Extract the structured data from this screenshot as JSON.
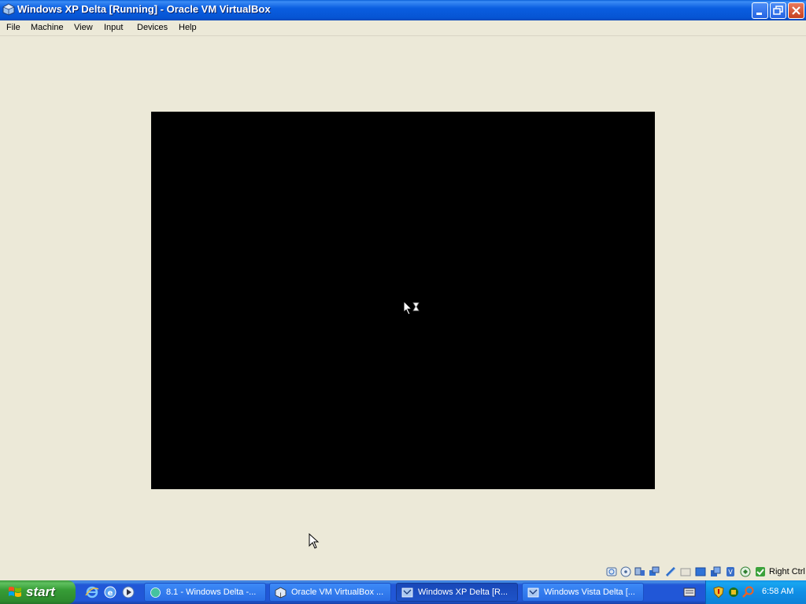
{
  "window": {
    "title": "Windows XP Delta [Running] - Oracle VM VirtualBox",
    "icon": "virtualbox-icon",
    "controls": [
      "minimize-icon",
      "restore-icon",
      "close-icon"
    ]
  },
  "menu": [
    "File",
    "Machine",
    "View",
    "Input",
    "Devices",
    "Help"
  ],
  "vm_screen": {
    "background": "#000000",
    "cursor": "busy-cursor-icon"
  },
  "statusbar": {
    "icons": [
      "hard-disk-icon",
      "optical-drive-icon",
      "audio-icon",
      "network-icon",
      "usb-icon",
      "shared-folders-icon",
      "display-icon",
      "video-capture-icon",
      "virtualization-icon",
      "mouse-integration-icon",
      "guest-additions-icon"
    ],
    "host_key": "Right Ctrl"
  },
  "taskbar": {
    "start_label": "start",
    "quick_launch": [
      "internet-explorer-icon",
      "windows-explorer-icon",
      "media-player-icon"
    ],
    "tasks": [
      {
        "label": "8.1 - Windows Delta -...",
        "icon": "window-app-icon",
        "active": false
      },
      {
        "label": "Oracle VM VirtualBox ...",
        "icon": "virtualbox-icon",
        "active": false
      },
      {
        "label": "Windows XP Delta [R...",
        "icon": "virtualbox-vm-icon",
        "active": true
      },
      {
        "label": "Windows Vista Delta [...",
        "icon": "virtualbox-vm-icon",
        "active": false
      }
    ],
    "tray_icons": [
      "keyboard-icon",
      "security-shield-icon",
      "antivirus-icon",
      "search-icon"
    ],
    "clock": "6:58 AM"
  },
  "colors": {
    "titlebar": "#0a5ee0",
    "taskbar": "#2157d7",
    "start": "#379d37",
    "desktop_bg": "#ece9d8"
  }
}
